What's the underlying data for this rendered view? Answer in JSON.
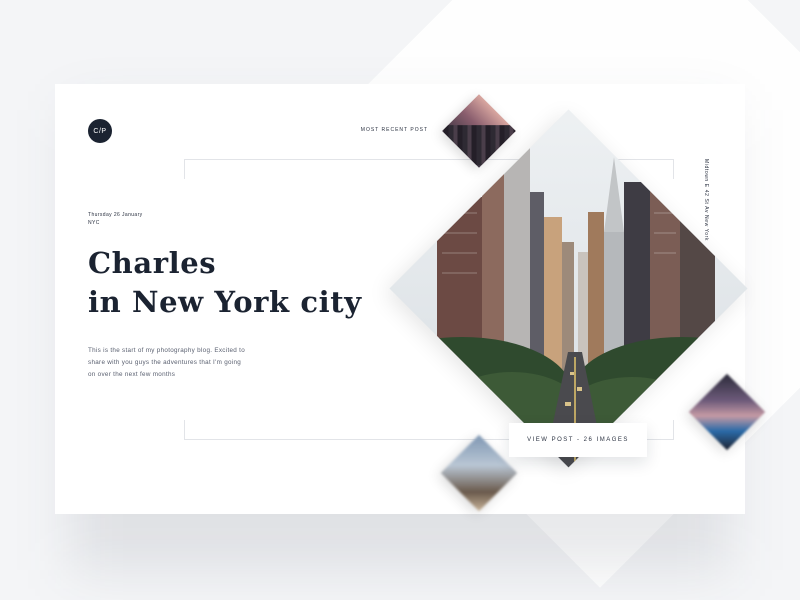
{
  "logo": {
    "text": "C/P"
  },
  "header": {
    "most_recent_label": "MOST RECENT POST"
  },
  "post": {
    "date": "Thursday 26 January",
    "location": "NYC",
    "title_line1": "Charles",
    "title_line2": "in New York city",
    "intro": "This is the start of my photography blog. Excited to share with you guys the adventures that I'm going on over the next few months",
    "side_caption": "Midtown E 42 St Av New York",
    "button_label": "VIEW POST - 26 IMAGES"
  },
  "images": {
    "main": "city-street-skyscrapers-photo",
    "thumb_top": "city-skyline-sunset-photo",
    "thumb_bottom": "city-street-blurred-photo",
    "thumb_right": "city-lights-night-photo"
  },
  "colors": {
    "background": "#f4f5f7",
    "card": "#ffffff",
    "text_dark": "#1b2331",
    "text_muted": "#5a6070"
  }
}
